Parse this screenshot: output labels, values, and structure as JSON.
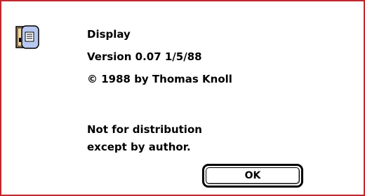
{
  "dialog": {
    "icon": "display-app-icon",
    "lines": [
      "Display",
      "Version 0.07 1/5/88",
      "© 1988 by Thomas Knoll"
    ],
    "note": [
      "Not for distribution",
      "except by author."
    ],
    "ok_label": "OK"
  },
  "colors": {
    "border": "#c1272d",
    "icon_page": "#b8c8f0"
  }
}
